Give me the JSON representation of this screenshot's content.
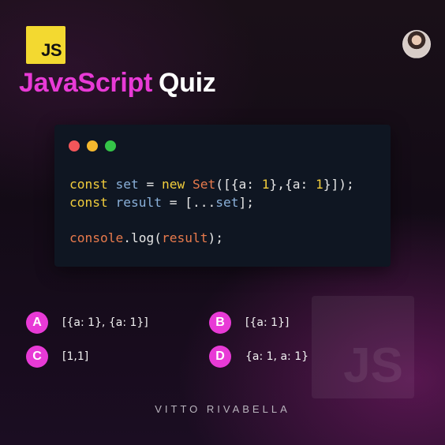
{
  "logo": {
    "text": "JS",
    "color": "#f3d930"
  },
  "avatar": {
    "icon": "author-avatar"
  },
  "title": {
    "part1": "JavaScript",
    "part2": "Quiz",
    "accent": "#e83ad6"
  },
  "code_window": {
    "dots": [
      "#f2565a",
      "#f5b82e",
      "#35c448"
    ],
    "lines": [
      {
        "tokens": [
          {
            "t": "const",
            "k": "kw"
          },
          {
            "t": " ",
            "k": "op"
          },
          {
            "t": "set",
            "k": "var"
          },
          {
            "t": " = ",
            "k": "op"
          },
          {
            "t": "new",
            "k": "kw"
          },
          {
            "t": " ",
            "k": "op"
          },
          {
            "t": "Set",
            "k": "cls"
          },
          {
            "t": "([{a: ",
            "k": "op"
          },
          {
            "t": "1",
            "k": "num"
          },
          {
            "t": "},{a: ",
            "k": "op"
          },
          {
            "t": "1",
            "k": "num"
          },
          {
            "t": "}]);",
            "k": "op"
          }
        ]
      },
      {
        "tokens": [
          {
            "t": "const",
            "k": "kw"
          },
          {
            "t": " ",
            "k": "op"
          },
          {
            "t": "result",
            "k": "var"
          },
          {
            "t": " = [...",
            "k": "op"
          },
          {
            "t": "set",
            "k": "var"
          },
          {
            "t": "];",
            "k": "op"
          }
        ]
      },
      {
        "blank": true
      },
      {
        "tokens": [
          {
            "t": "console",
            "k": "obj"
          },
          {
            "t": ".log(",
            "k": "op"
          },
          {
            "t": "result",
            "k": "obj"
          },
          {
            "t": ");",
            "k": "op"
          }
        ]
      }
    ]
  },
  "options": [
    {
      "letter": "A",
      "text": "[{a: 1}, {a: 1}]"
    },
    {
      "letter": "B",
      "text": "[{a: 1}]"
    },
    {
      "letter": "C",
      "text": "[1,1]"
    },
    {
      "letter": "D",
      "text": "{a: 1, a: 1}"
    }
  ],
  "watermark": {
    "text": "JS"
  },
  "footer": {
    "author": "VITTO RIVABELLA"
  }
}
